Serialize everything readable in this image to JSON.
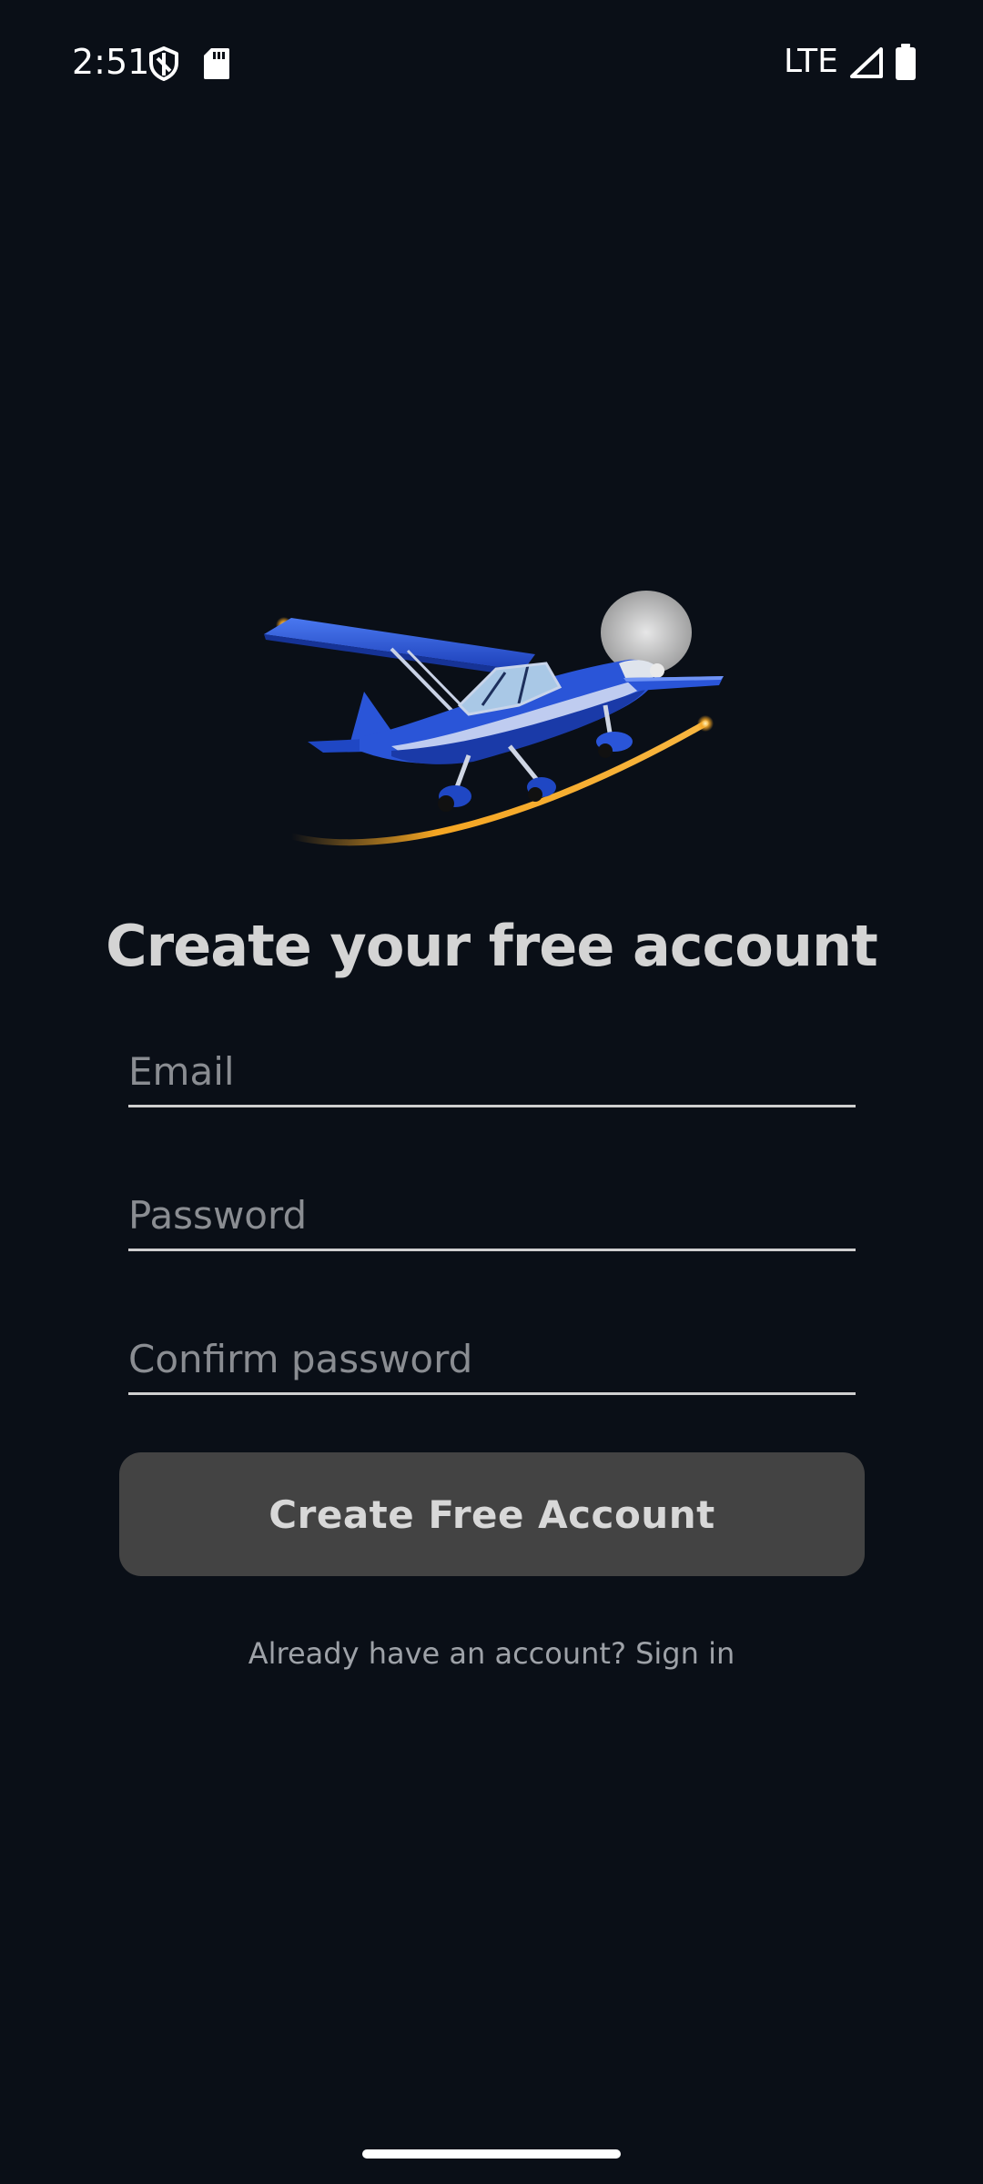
{
  "status_bar": {
    "time": "2:51",
    "network": "LTE",
    "icons": [
      "shield-icon",
      "sdcard-icon",
      "signal-icon",
      "battery-icon"
    ]
  },
  "hero": {
    "icon": "airplane-illustration"
  },
  "signup": {
    "title": "Create your free account",
    "email_placeholder": "Email",
    "email_value": "",
    "password_placeholder": "Password",
    "password_value": "",
    "confirm_placeholder": "Confirm password",
    "confirm_value": "",
    "create_button_label": "Create Free Account",
    "signin_text": "Already have an account? Sign in"
  },
  "colors": {
    "background": "#0a0f17",
    "button": "#434343",
    "plane_blue": "#2a55d8",
    "trail_orange": "#f5a623"
  }
}
